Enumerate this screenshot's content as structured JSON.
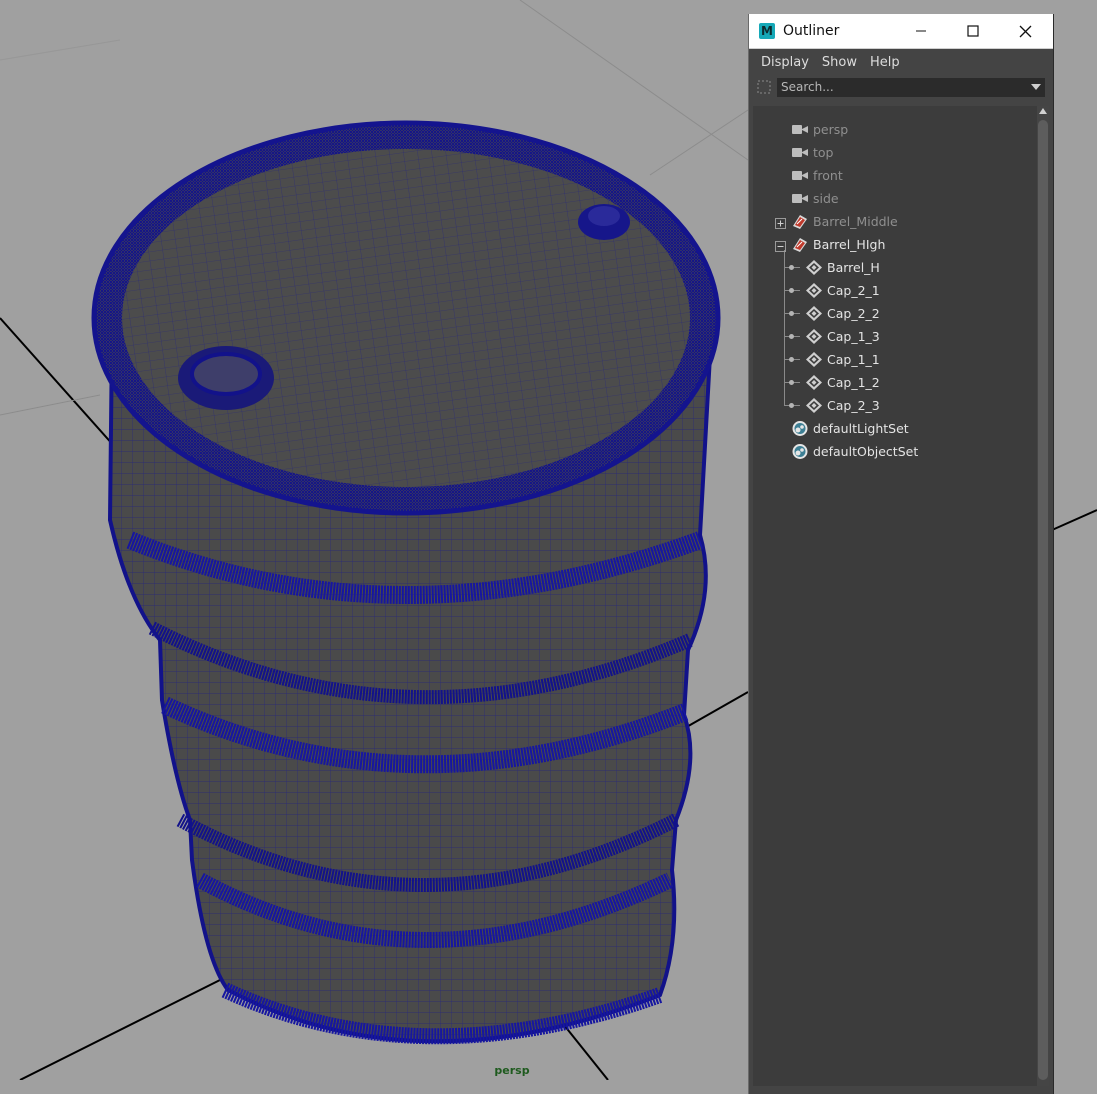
{
  "viewport": {
    "camera_label": "persp"
  },
  "outliner": {
    "title": "Outliner",
    "app_icon_letter": "M",
    "menu": [
      "Display",
      "Show",
      "Help"
    ],
    "search": {
      "placeholder": "Search..."
    },
    "tree": [
      {
        "label": "persp",
        "icon": "camera-icon",
        "dimmed": true
      },
      {
        "label": "top",
        "icon": "camera-icon",
        "dimmed": true
      },
      {
        "label": "front",
        "icon": "camera-icon",
        "dimmed": true
      },
      {
        "label": "side",
        "icon": "camera-icon",
        "dimmed": true
      },
      {
        "label": "Barrel_Middle",
        "icon": "group-icon",
        "dimmed": true,
        "expander": "collapsed"
      },
      {
        "label": "Barrel_HIgh",
        "icon": "group-icon",
        "dimmed": false,
        "expander": "expanded"
      },
      {
        "label": "Barrel_H",
        "icon": "mesh-icon",
        "dimmed": false,
        "child": true
      },
      {
        "label": "Cap_2_1",
        "icon": "mesh-icon",
        "dimmed": false,
        "child": true
      },
      {
        "label": "Cap_2_2",
        "icon": "mesh-icon",
        "dimmed": false,
        "child": true
      },
      {
        "label": "Cap_1_3",
        "icon": "mesh-icon",
        "dimmed": false,
        "child": true
      },
      {
        "label": "Cap_1_1",
        "icon": "mesh-icon",
        "dimmed": false,
        "child": true
      },
      {
        "label": "Cap_1_2",
        "icon": "mesh-icon",
        "dimmed": false,
        "child": true
      },
      {
        "label": "Cap_2_3",
        "icon": "mesh-icon",
        "dimmed": false,
        "child": true,
        "last": true
      },
      {
        "label": "defaultLightSet",
        "icon": "set-icon",
        "dimmed": false
      },
      {
        "label": "defaultObjectSet",
        "icon": "set-icon",
        "dimmed": false
      }
    ]
  },
  "colors": {
    "viewport_bg": "#a0a0a0",
    "wireframe": "#1a1a8c",
    "mesh_fill": "#4a4a4a",
    "panel_bg": "#444444",
    "tree_bg": "#3c3c3c",
    "camera_label": "#1e5a1e"
  }
}
